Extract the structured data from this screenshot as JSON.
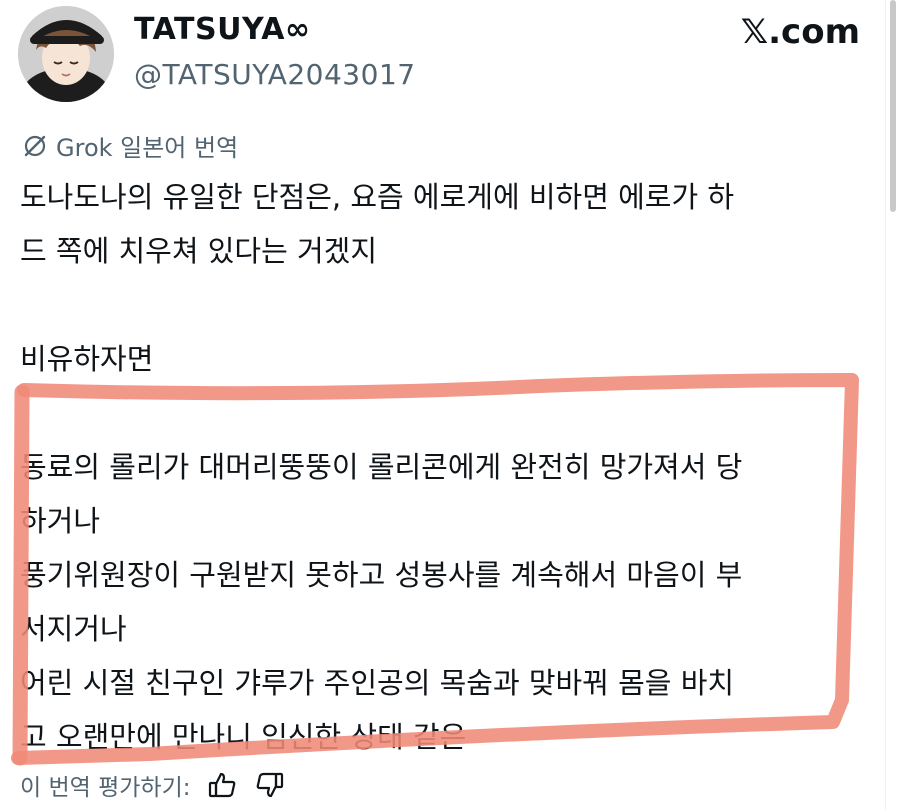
{
  "author": {
    "display_name": "TATSUYA∞",
    "handle": "@TATSUYA2043017"
  },
  "source": {
    "label": "𝕏.com"
  },
  "translation": {
    "label": "Grok 일본어 번역",
    "icon": "grok-icon"
  },
  "post": {
    "text": "도나도나의 유일한 단점은, 요즘 에로게에 비하면 에로가 하\n드 쪽에 치우쳐 있다는 거겠지\n\n비유하자면\n\n동료의 롤리가 대머리뚱뚱이 롤리콘에게 완전히 망가져서 당\n하거나\n풍기위원장이 구원받지 못하고 성봉사를 계속해서 마음이 부\n서지거나\n어린 시절 친구인 갸루가 주인공의 목숨과 맞바꿔 몸을 바치\n고 오랜만에 만나니 임신한 상태 같은"
  },
  "feedback": {
    "label": "이 번역 평가하기:",
    "thumbs_up_icon": "thumbs-up-icon",
    "thumbs_down_icon": "thumbs-down-icon"
  },
  "colors": {
    "text": "#0f1419",
    "secondary": "#536471",
    "highlight_marker": "#f08a78"
  }
}
